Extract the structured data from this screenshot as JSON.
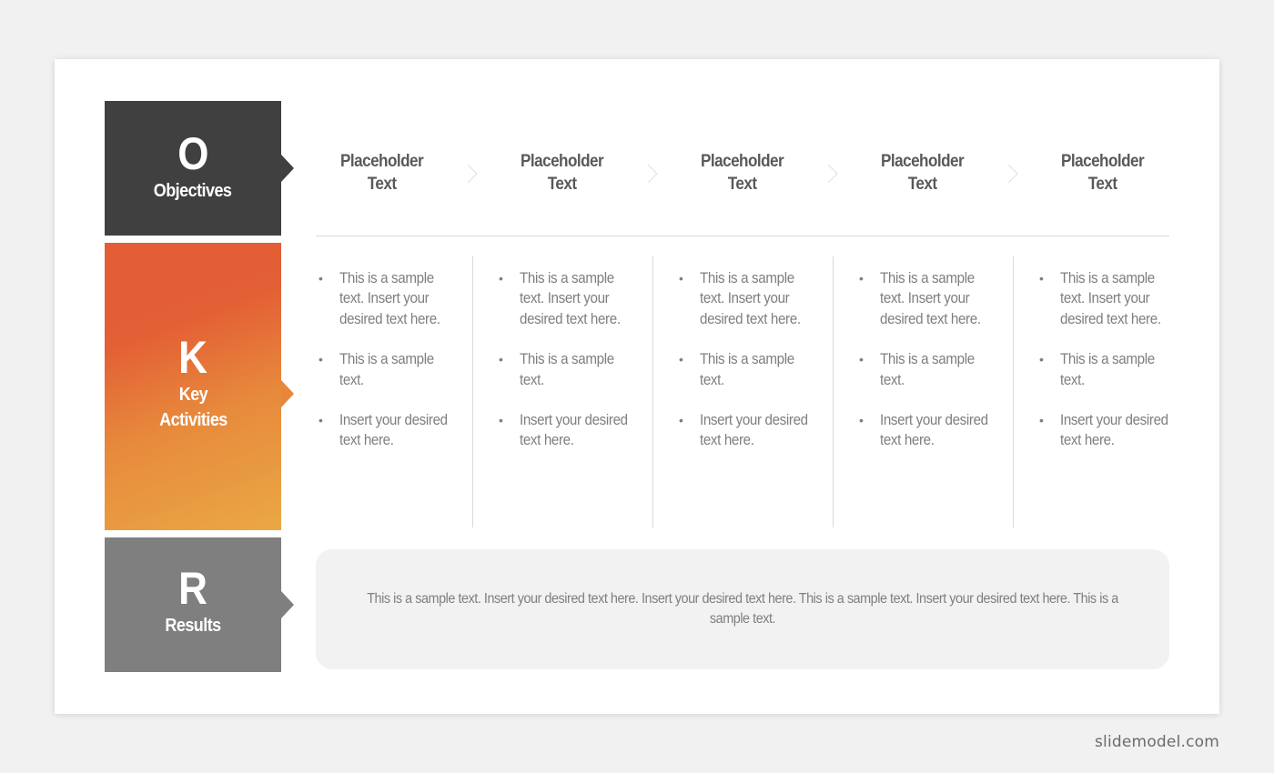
{
  "slide": {
    "blocks": [
      {
        "letter": "O",
        "label": "Objectives",
        "color": "#404040"
      },
      {
        "letter": "K",
        "label_line1": "Key",
        "label_line2": "Activities",
        "gradient_start": "#e35d35",
        "gradient_end": "#eaa845"
      },
      {
        "letter": "R",
        "label": "Results",
        "color": "#7f7f7f"
      }
    ],
    "objectives": [
      {
        "line1": "Placeholder",
        "line2": "Text"
      },
      {
        "line1": "Placeholder",
        "line2": "Text"
      },
      {
        "line1": "Placeholder",
        "line2": "Text"
      },
      {
        "line1": "Placeholder",
        "line2": "Text"
      },
      {
        "line1": "Placeholder",
        "line2": "Text"
      }
    ],
    "activities": [
      {
        "bullets": [
          "This is a sample text. Insert your desired text here.",
          "This is a sample text.",
          "Insert your desired text here."
        ]
      },
      {
        "bullets": [
          "This is a sample text. Insert your desired text here.",
          "This is a sample text.",
          "Insert your desired text here."
        ]
      },
      {
        "bullets": [
          "This is a sample text. Insert your desired text here.",
          "This is a sample text.",
          "Insert your desired text here."
        ]
      },
      {
        "bullets": [
          "This is a sample text. Insert your desired text here.",
          "This is a sample text.",
          "Insert your desired text here."
        ]
      },
      {
        "bullets": [
          "This is a sample text. Insert your desired text here.",
          "This is a sample text.",
          "Insert your desired text here."
        ]
      }
    ],
    "results_text": "This is a sample text. Insert your desired text here. Insert your desired  text here. This is a sample text. Insert your desired text here. This is a sample text."
  },
  "watermark": "slidemodel.com",
  "colors": {
    "background": "#f1f1f1",
    "slide": "#ffffff",
    "heading_text": "#595959",
    "body_text": "#7f7f7f",
    "divider": "#d9d9d9",
    "results_box": "#f2f2f2"
  }
}
